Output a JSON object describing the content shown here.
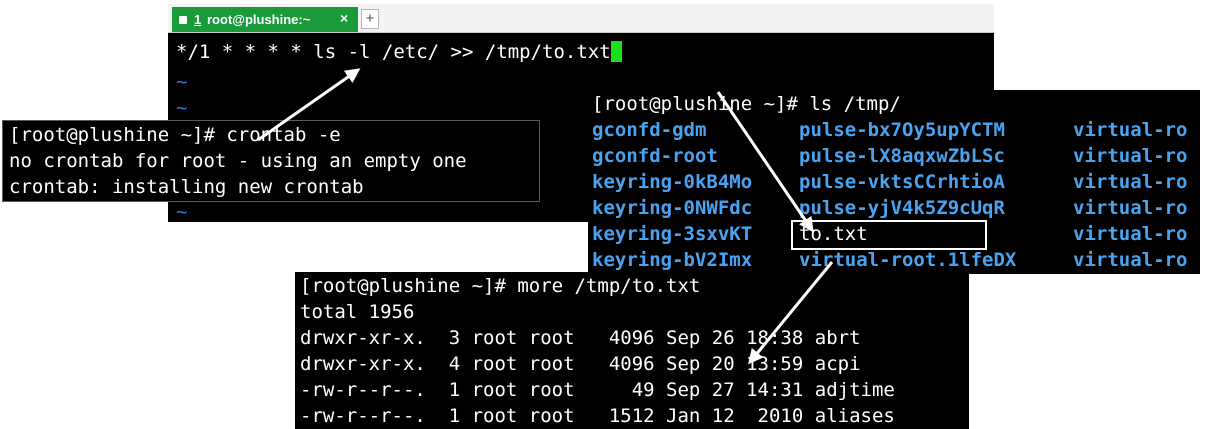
{
  "vim_tab": {
    "number": "1",
    "title": "root@plushine:~",
    "close_glyph": "×",
    "add_glyph": "+"
  },
  "vim": {
    "command_line": "*/1 * * * * ls -l /etc/ >> /tmp/to.txt",
    "tilde": "~"
  },
  "crontab_terminal": {
    "lines": [
      "[root@plushine ~]# crontab -e",
      "no crontab for root - using an empty one",
      "crontab: installing new crontab"
    ]
  },
  "ls_terminal": {
    "prompt": "[root@plushine ~]# ls /tmp/",
    "columns": [
      [
        "gconfd-gdm",
        "gconfd-root",
        "keyring-0kB4Mo",
        "keyring-0NWFdc",
        "keyring-3sxvKT",
        "keyring-bV2Imx"
      ],
      [
        "pulse-bx7Oy5upYCTM",
        "pulse-lX8aqxwZbLSc",
        "pulse-vktsCCrhtioA",
        "pulse-yjV4k5Z9cUqR",
        "to.txt",
        "virtual-root.1lfeDX"
      ],
      [
        "virtual-ro",
        "virtual-ro",
        "virtual-ro",
        "virtual-ro",
        "virtual-ro",
        "virtual-ro"
      ]
    ],
    "highlighted_file": "to.txt"
  },
  "more_terminal": {
    "lines": [
      "[root@plushine ~]# more /tmp/to.txt",
      "total 1956",
      "drwxr-xr-x.  3 root root   4096 Sep 26 18:38 abrt",
      "drwxr-xr-x.  4 root root   4096 Sep 20 13:59 acpi",
      "-rw-r--r--.  1 root root     49 Sep 27 14:31 adjtime",
      "-rw-r--r--.  1 root root   1512 Jan 12  2010 aliases"
    ]
  },
  "colors": {
    "tab_active": "#1a9a3a",
    "cursor": "#19e019",
    "tilde": "#2e7fd2",
    "directory_blue": "#4aa3f0",
    "terminal_bg": "#000000"
  }
}
